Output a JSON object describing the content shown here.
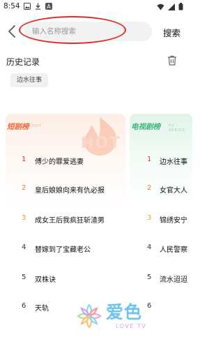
{
  "status_bar": {
    "time": "8:54"
  },
  "search": {
    "placeholder": "输入名称搜索",
    "value": "",
    "button_label": "搜索"
  },
  "history": {
    "title": "历史记录",
    "items": [
      "边水往事"
    ]
  },
  "short_drama": {
    "title": "短剧榜",
    "subtitle": "HOT",
    "badge": "HOT",
    "items": [
      {
        "rank": "1",
        "title": "傅少的罪爱逃妻"
      },
      {
        "rank": "2",
        "title": "皇后娘娘向来有仇必报"
      },
      {
        "rank": "3",
        "title": "成女王后我疯狂斩渣男"
      },
      {
        "rank": "4",
        "title": "替嫁到了宝藏老公"
      },
      {
        "rank": "5",
        "title": "双株诀"
      },
      {
        "rank": "6",
        "title": "天轨"
      }
    ]
  },
  "tv_drama": {
    "title": "电视剧榜",
    "subtitle": "TV SERIES",
    "items": [
      {
        "rank": "1",
        "title": "边水往事"
      },
      {
        "rank": "2",
        "title": "女官大人"
      },
      {
        "rank": "3",
        "title": "锦绣安宁"
      },
      {
        "rank": "4",
        "title": "人民警察"
      },
      {
        "rank": "5",
        "title": "流水迢迢"
      },
      {
        "rank": "6",
        "title": ""
      }
    ]
  },
  "watermark": {
    "cn": "爱色",
    "en": "LOVE TV"
  },
  "colors": {
    "accent_red": "#e4382f",
    "short_title": "#ef6a3c",
    "tv_title": "#3cb77a",
    "annotation": "#e02a2a"
  }
}
